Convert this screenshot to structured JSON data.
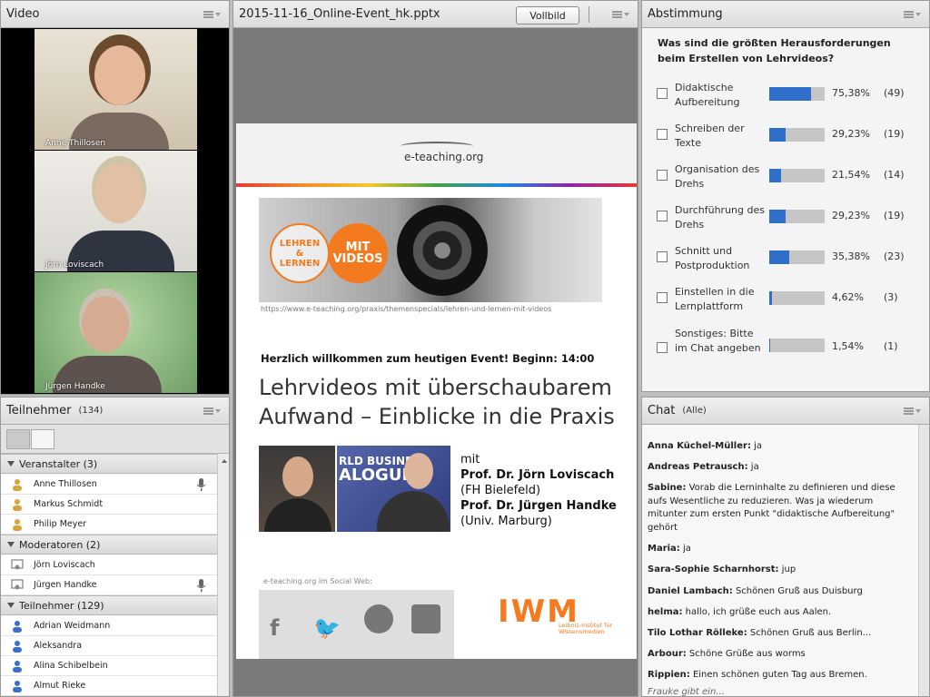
{
  "video": {
    "title": "Video",
    "feeds": [
      {
        "name": "Anne Thillosen"
      },
      {
        "name": "Jörn Loviscach"
      },
      {
        "name": "Jürgen Handke"
      }
    ]
  },
  "presentation": {
    "title": "2015-11-16_Online-Event_hk.pptx",
    "fullscreen_label": "Vollbild",
    "slide": {
      "logo": "e-teaching.org",
      "badge_left_l1": "LEHREN",
      "badge_left_l2": "&",
      "badge_left_l3": "LERNEN",
      "badge_right_l1": "MIT",
      "badge_right_l2": "VIDEOS",
      "url": "https://www.e-teaching.org/praxis/themenspecials/lehren-und-lernen-mit-videos",
      "welcome": "Herzlich willkommen zum heutigen Event! Beginn: 14:00",
      "title_l1": "Lehrvideos mit überschaubarem",
      "title_l2": "Aufwand – Einblicke in die Praxis",
      "photo_banner_l1": "RLD BUSINESS",
      "photo_banner_l2": "ALOGUE",
      "speaker_intro": "mit",
      "speaker1": "Prof. Dr. Jörn Loviscach",
      "speaker1_aff": "(FH Bielefeld)",
      "speaker2": "Prof. Dr. Jürgen Handke",
      "speaker2_aff": "(Univ. Marburg)",
      "social_label": "e-teaching.org im Social Web:",
      "iwm": "IWM",
      "iwm_sub_l1": "Leibniz-Institut für",
      "iwm_sub_l2": "Wissensmedien"
    }
  },
  "poll": {
    "title": "Abstimmung",
    "question": "Was sind die größten Herausforderungen beim Erstellen von Lehrvideos?",
    "options": [
      {
        "label": "Didaktische Aufbereitung",
        "percent": 75.38,
        "percent_text": "75,38%",
        "count_text": "(49)"
      },
      {
        "label": "Schreiben der Texte",
        "percent": 29.23,
        "percent_text": "29,23%",
        "count_text": "(19)"
      },
      {
        "label": "Organisation des Drehs",
        "percent": 21.54,
        "percent_text": "21,54%",
        "count_text": "(14)"
      },
      {
        "label": "Durchführung des Drehs",
        "percent": 29.23,
        "percent_text": "29,23%",
        "count_text": "(19)"
      },
      {
        "label": "Schnitt und Postproduktion",
        "percent": 35.38,
        "percent_text": "35,38%",
        "count_text": "(23)"
      },
      {
        "label": "Einstellen in die Lernplattform",
        "percent": 4.62,
        "percent_text": "4,62%",
        "count_text": "(3)"
      },
      {
        "label": "Sonstiges: Bitte im Chat angeben",
        "percent": 1.54,
        "percent_text": "1,54%",
        "count_text": "(1)"
      }
    ],
    "bar_color": "#2f6fc9"
  },
  "attendees": {
    "title": "Teilnehmer",
    "count": "(134)",
    "groups": [
      {
        "label": "Veranstalter (3)",
        "members": [
          "Anne Thillosen",
          "Markus Schmidt",
          "Philip Meyer"
        ]
      },
      {
        "label": "Moderatoren (2)",
        "members": [
          "Jörn Loviscach",
          "Jürgen Handke"
        ]
      },
      {
        "label": "Teilnehmer (129)",
        "members": [
          "Adrian Weidmann",
          "Aleksandra",
          "Alina Schibelbein",
          "Almut Rieke"
        ]
      }
    ]
  },
  "chat": {
    "title": "Chat",
    "scope": "(Alle)",
    "messages": [
      {
        "who": "Anna Küchel-Müller:",
        "text": " ja"
      },
      {
        "who": "Andreas Petrausch:",
        "text": " ja"
      },
      {
        "who": "Sabine:",
        "text": " Vorab die Lerninhalte zu definieren und diese aufs Wesentliche zu reduzieren. Was ja wiederum mitunter zum ersten Punkt \"didaktische Aufbereitung\" gehört"
      },
      {
        "who": "Maria:",
        "text": " ja"
      },
      {
        "who": "Sara-Sophie Scharnhorst:",
        "text": " jup"
      },
      {
        "who": "Daniel Lambach:",
        "text": " Schönen Gruß aus Duisburg"
      },
      {
        "who": "helma:",
        "text": " hallo, ich grüße euch aus Aalen."
      },
      {
        "who": "Tilo Lothar Rölleke:",
        "text": " Schönen Gruß aus Berlin..."
      },
      {
        "who": "Arbour:",
        "text": " Schöne Grüße aus worms"
      },
      {
        "who": "Rippien:",
        "text": " Einen schönen guten Tag aus Bremen."
      }
    ],
    "typing": "Frauke gibt ein..."
  }
}
